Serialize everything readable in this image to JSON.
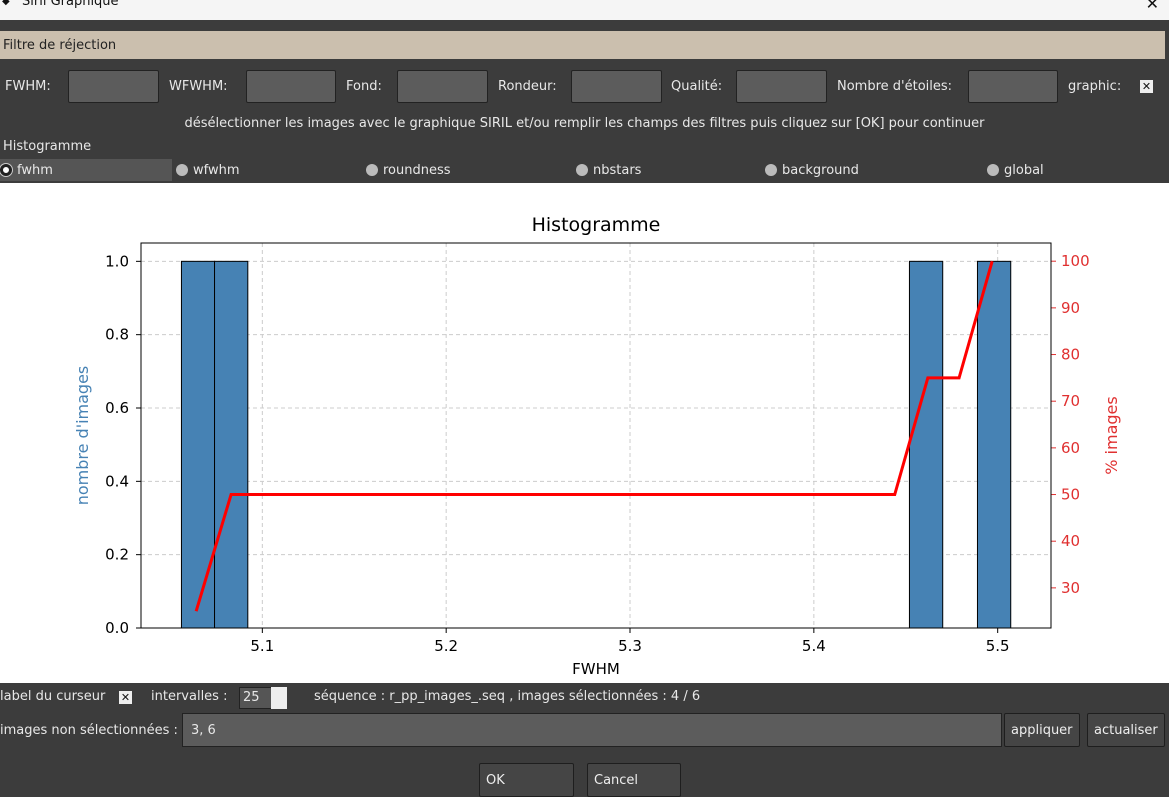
{
  "window": {
    "title": "Siril Graphique",
    "close": "✕"
  },
  "frame_title": "Filtre de réjection",
  "filters": [
    {
      "label": "FWHM:",
      "value": ""
    },
    {
      "label": "WFWHM:",
      "value": ""
    },
    {
      "label": "Fond:",
      "value": ""
    },
    {
      "label": "Rondeur:",
      "value": ""
    },
    {
      "label": "Qualité:",
      "value": ""
    },
    {
      "label": "Nombre d'étoiles:",
      "value": ""
    }
  ],
  "graphic_label": "graphic:",
  "graphic_checked": "✕",
  "hint": "désélectionner les images avec le graphique SIRIL et/ou remplir les champs des filtres puis cliquez sur [OK] pour continuer",
  "histogram_label": "Histogramme",
  "radios": [
    "fwhm",
    "wfwhm",
    "roundness",
    "nbstars",
    "background",
    "global"
  ],
  "selected_radio": "fwhm",
  "chart_data": {
    "type": "bar",
    "title": "Histogramme",
    "xlabel": "FWHM",
    "ylabel": "nombre d'images",
    "y2label": "% images",
    "xlim": [
      5.034,
      5.529
    ],
    "ylim": [
      0,
      1.05
    ],
    "y2lim": [
      21.4,
      103.9
    ],
    "xticks": [
      "5.1",
      "5.2",
      "5.3",
      "5.4",
      "5.5"
    ],
    "yticks": [
      "0.0",
      "0.2",
      "0.4",
      "0.6",
      "0.8",
      "1.0"
    ],
    "y2ticks": [
      "30",
      "40",
      "50",
      "60",
      "70",
      "80",
      "90",
      "100"
    ],
    "bin_width": 0.0181,
    "bars": [
      {
        "x": 5.056,
        "value": 1
      },
      {
        "x": 5.074,
        "value": 1
      },
      {
        "x": 5.452,
        "value": 1
      },
      {
        "x": 5.489,
        "value": 1
      }
    ],
    "cumulative": {
      "name": "% images",
      "x": [
        5.064,
        5.083,
        5.444,
        5.462,
        5.479,
        5.497
      ],
      "y": [
        25,
        50,
        50,
        75,
        75,
        100
      ]
    },
    "colors": {
      "bar": "#4682b4",
      "line": "#ff0000",
      "ylabel": "#4682b4",
      "y2": "#e03030"
    },
    "grid": true
  },
  "bottom": {
    "cursor_label": "label du curseur",
    "cursor_checked": "✕",
    "intervals_label": "intervalles :",
    "intervals_value": "25",
    "sequence_info": "séquence : r_pp_images_.seq ,  images sélectionnées : 4 / 6",
    "unselected_label": "images non sélectionnées :",
    "unselected_value": "3, 6",
    "apply": "appliquer",
    "refresh": "actualiser",
    "ok": "OK",
    "cancel": "Cancel"
  }
}
